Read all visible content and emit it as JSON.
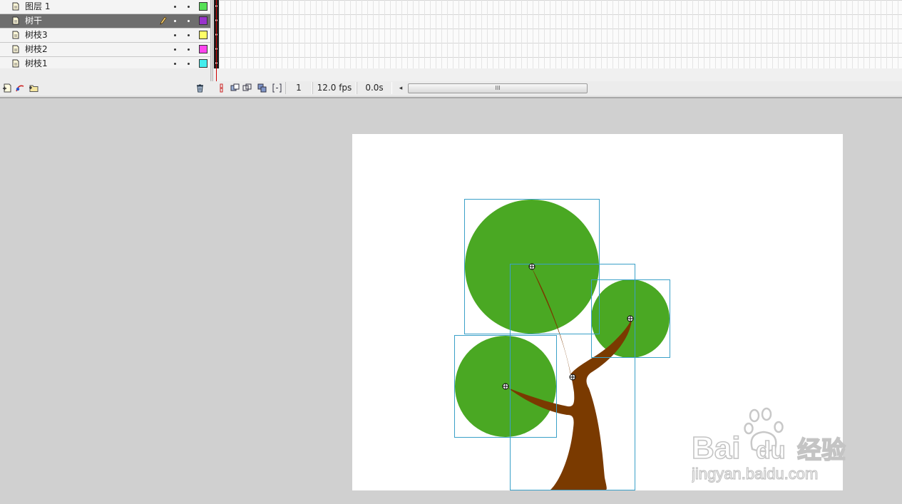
{
  "timeline": {
    "layers": [
      {
        "name": "图层 1",
        "color": "#55e055",
        "selected": false
      },
      {
        "name": "树干",
        "color": "#9933cc",
        "selected": true
      },
      {
        "name": "树枝3",
        "color": "#ffff66",
        "selected": false
      },
      {
        "name": "树枝2",
        "color": "#ff44ee",
        "selected": false
      },
      {
        "name": "树枝1",
        "color": "#44eeee",
        "selected": false
      }
    ],
    "layer_icon": "layer-page-icon",
    "edit_icon": "pencil-icon"
  },
  "toolbar": {
    "left_icons": [
      "new-layer-icon",
      "add-motion-guide-icon",
      "new-folder-icon"
    ],
    "delete_icon": "trash-icon",
    "frame_icons": [
      "center-frame-icon",
      "onion-skin-icon",
      "onion-skin-outlines-icon",
      "edit-multiple-frames-icon",
      "modify-onion-markers-icon"
    ],
    "current_frame": "1",
    "frame_rate": "12.0 fps",
    "elapsed_time": "0.0s",
    "scroll_left": "◂",
    "scroll_grip": "III"
  },
  "stage": {
    "background": "#ffffff",
    "canopy_color": "#4aa823",
    "trunk_color": "#7a3a00",
    "selection_color": "#3aa0c8"
  },
  "watermark": {
    "brand": "Bai",
    "brand_suffix": "du",
    "product": "经验",
    "url": "jingyan.baidu.com"
  }
}
